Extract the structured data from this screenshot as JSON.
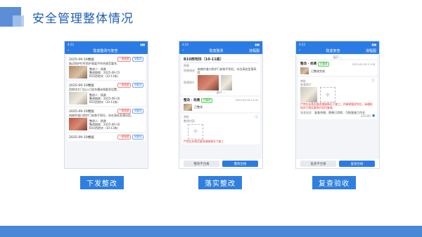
{
  "page": {
    "title": "安全管理整体情况"
  },
  "phones": {
    "p1": {
      "time": "4:22",
      "nav_title": "隐患整改与复查",
      "nav_action": "",
      "items": [
        {
          "date": "2025-09-10楼层",
          "chip1": "一般隐患",
          "chip2": "待整改",
          "desc": "临边防护栏杆防护高度不符合规范要求，",
          "reporter": "整改人：杨勇",
          "deadline": "整改期限：2025-09-15",
          "location": "B10西地块（10-11栋）"
        },
        {
          "date": "2025-09-10楼层",
          "chip1": "一般隐患",
          "chip2": "待整改",
          "desc": "西地块大门出入口洗车槽未按要求设置，",
          "reporter": "整改人：杨勇",
          "deadline": "整改期限：2025-09-16",
          "location": "B10西地块（10-11栋）"
        },
        {
          "date": "2025-09-10楼层",
          "chip1": "一般隐患",
          "chip2": "待整改",
          "desc": "电梯井道口防护门安装不到位，存在高处坠落风险，",
          "reporter": "整改人：杨勇",
          "deadline": "整改期限：2025-09-16",
          "location": "B10西地块（10-11栋）"
        },
        {
          "date": "2025-09-10楼层",
          "chip1": "一般隐患",
          "chip2": "待整改"
        }
      ]
    },
    "p2": {
      "time": "4:22",
      "nav_title": "隐患整改",
      "nav_action": "流程图",
      "location": "B10西地块（10-11栋）",
      "field1_label": "隐患",
      "field2_label": "隐患描述",
      "field2_value": "电梯井道口防护门安装不到位，存在高处坠落风险",
      "field3_label": "隐患照片",
      "expand": "展开",
      "handler": "整改 · 杨勇",
      "handler_chip": "已整改",
      "handler_time": "2025-09-16 11:00",
      "handler_note": "已整改",
      "field4_label": "审批",
      "field5_label": "整改内容",
      "red_note": "严禁在未落实整改措施情况下复工",
      "btn_left": "整改不合格",
      "btn_right": "整改合格"
    },
    "p3": {
      "time": "4:22",
      "nav_title": "隐患复查",
      "nav_action": "流程图",
      "expand": "展开",
      "handler": "整改 · 杨勇",
      "handler_chip": "已整改",
      "handler_time": "2025-09-16 17:08",
      "handler_note": "已整改完成",
      "field1_label": "审批",
      "field2_label": "复查照片",
      "red_note": "严禁在未落实整改措施情况下复工，并确保整改到位，请通知相关方落实整改并及时复查。",
      "field3_label": "复查描述",
      "field3_value": "复查合格，隐患已消除，可恢复施工作业",
      "count": "22/100",
      "btn_left": "复查不合格",
      "btn_right": "复查合格"
    }
  },
  "labels": {
    "l1": "下发整改",
    "l2": "落实整改",
    "l3": "复查验收"
  }
}
